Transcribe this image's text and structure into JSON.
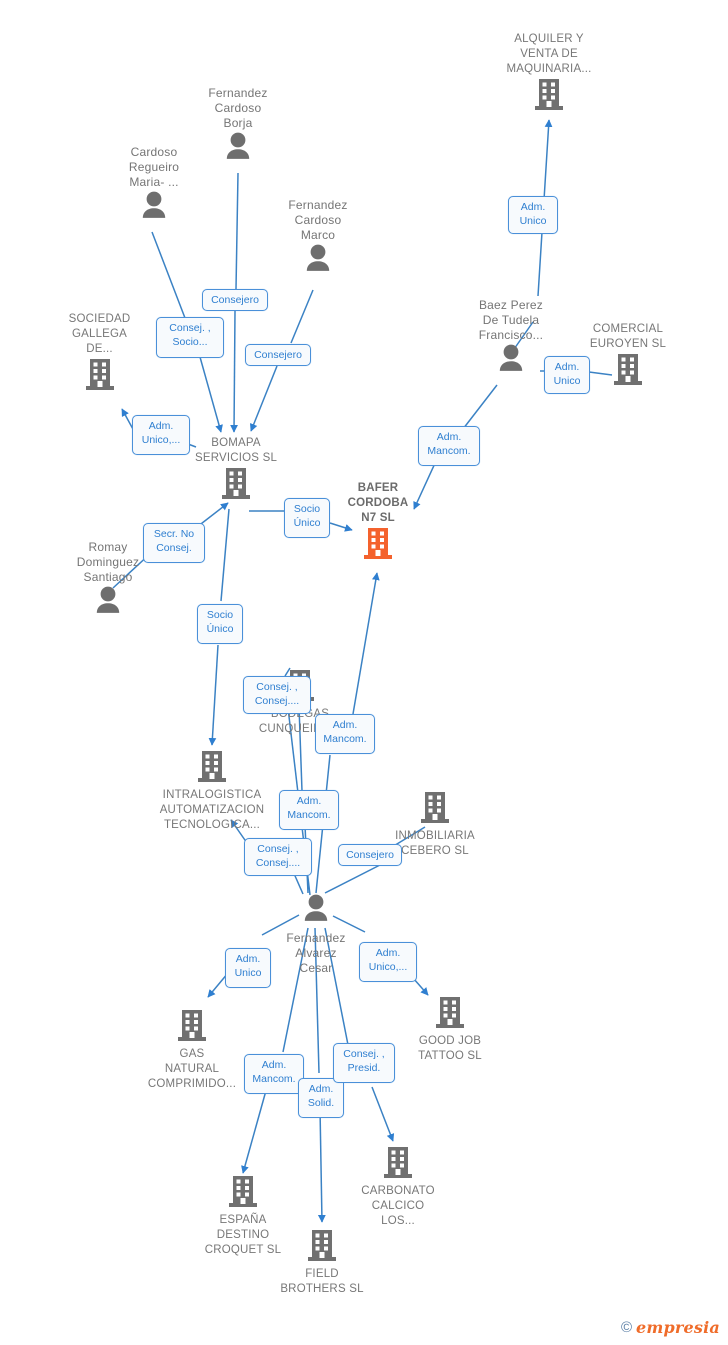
{
  "diagram": {
    "type": "corporate-relations-graph",
    "colors": {
      "focus_company": "#f4622d",
      "company": "#707070",
      "person": "#6e6e6e",
      "edge": "#3b82c4",
      "label_text": "#2f7fd0",
      "label_border": "#4a90d9",
      "caption_text": "#777777"
    },
    "focus_node": "BAFER CORDOBA N7 SL"
  },
  "nodes": [
    {
      "id": "alquiler",
      "kind": "company",
      "focus": false,
      "label": "ALQUILER Y\nVENTA DE\nMAQUINARIA..."
    },
    {
      "id": "fcborja",
      "kind": "person",
      "focus": false,
      "label": "Fernandez\nCardoso\nBorja"
    },
    {
      "id": "cardosomaria",
      "kind": "person",
      "focus": false,
      "label": "Cardoso\nRegueiro\nMaria- ..."
    },
    {
      "id": "fcmarco",
      "kind": "person",
      "focus": false,
      "label": "Fernandez\nCardoso\nMarco"
    },
    {
      "id": "sociedad",
      "kind": "company",
      "focus": false,
      "label": "SOCIEDAD\nGALLEGA\nDE..."
    },
    {
      "id": "baez",
      "kind": "person",
      "focus": false,
      "label": "Baez Perez\nDe Tudela\nFrancisco..."
    },
    {
      "id": "comercial",
      "kind": "company",
      "focus": false,
      "label": "COMERCIAL\nEUROYEN SL"
    },
    {
      "id": "bomapa",
      "kind": "company",
      "focus": false,
      "label": "BOMAPA\nSERVICIOS SL"
    },
    {
      "id": "bafer",
      "kind": "company",
      "focus": true,
      "label": "BAFER\nCORDOBA\nN7  SL"
    },
    {
      "id": "romay",
      "kind": "person",
      "focus": false,
      "label": "Romay\nDominguez\nSantiago"
    },
    {
      "id": "bodegas",
      "kind": "company",
      "focus": false,
      "label": "BODEGAS\nCUNQUEIRO..."
    },
    {
      "id": "intralogistica",
      "kind": "company",
      "focus": false,
      "label": "INTRALOGISTICA\nAUTOMATIZACION\nTECNOLOGICA..."
    },
    {
      "id": "inmobiliaria",
      "kind": "company",
      "focus": false,
      "label": "INMOBILIARIA\nCEBERO SL"
    },
    {
      "id": "cesar",
      "kind": "person",
      "focus": false,
      "label": "Fernandez\nAlvarez\nCesar"
    },
    {
      "id": "gas",
      "kind": "company",
      "focus": false,
      "label": "GAS\nNATURAL\nCOMPRIMIDO..."
    },
    {
      "id": "goodjob",
      "kind": "company",
      "focus": false,
      "label": "GOOD JOB\nTATTOO  SL"
    },
    {
      "id": "espana",
      "kind": "company",
      "focus": false,
      "label": "ESPAÑA\nDESTINO\nCROQUET  SL"
    },
    {
      "id": "field",
      "kind": "company",
      "focus": false,
      "label": "FIELD\nBROTHERS  SL"
    },
    {
      "id": "carbonato",
      "kind": "company",
      "focus": false,
      "label": "CARBONATO\nCALCICO\nLOS..."
    }
  ],
  "relation_labels": [
    {
      "id": "r1",
      "text": "Consejero",
      "from": "fcborja",
      "to": "bomapa"
    },
    {
      "id": "r2",
      "text": "Consej. ,\nSocio...",
      "from": "cardosomaria",
      "to": "bomapa"
    },
    {
      "id": "r3",
      "text": "Consejero",
      "from": "fcmarco",
      "to": "bomapa"
    },
    {
      "id": "r4",
      "text": "Adm.\nUnico,...",
      "from": "bomapa",
      "to": "sociedad"
    },
    {
      "id": "r5",
      "text": "Adm.\nUnico",
      "from": "baez",
      "to": "alquiler"
    },
    {
      "id": "r6",
      "text": "Adm.\nUnico",
      "from": "baez",
      "to": "comercial"
    },
    {
      "id": "r7",
      "text": "Adm.\nMancom.",
      "from": "baez",
      "to": "bafer"
    },
    {
      "id": "r8",
      "text": "Socio\nÚnico",
      "from": "bomapa",
      "to": "bafer"
    },
    {
      "id": "r9",
      "text": "Secr.  No\nConsej.",
      "from": "romay",
      "to": "bomapa"
    },
    {
      "id": "r10",
      "text": "Socio\nÚnico",
      "from": "bomapa",
      "to": "intralogistica"
    },
    {
      "id": "r11",
      "text": "Consej. ,\nConsej....",
      "from": "cesar",
      "to": "bodegas"
    },
    {
      "id": "r12",
      "text": "Adm.\nMancom.",
      "from": "cesar",
      "to": "bafer"
    },
    {
      "id": "r13",
      "text": "Adm.\nMancom.",
      "from": "cesar",
      "to": "bodegas"
    },
    {
      "id": "r14",
      "text": "Consej. ,\nConsej....",
      "from": "cesar",
      "to": "intralogistica"
    },
    {
      "id": "r15",
      "text": "Consejero",
      "from": "cesar",
      "to": "inmobiliaria"
    },
    {
      "id": "r16",
      "text": "Adm.\nUnico",
      "from": "cesar",
      "to": "gas"
    },
    {
      "id": "r17",
      "text": "Adm.\nUnico,...",
      "from": "cesar",
      "to": "goodjob"
    },
    {
      "id": "r18",
      "text": "Adm.\nMancom.",
      "from": "cesar",
      "to": "espana"
    },
    {
      "id": "r19",
      "text": "Adm.\nSolid.",
      "from": "cesar",
      "to": "field"
    },
    {
      "id": "r20",
      "text": "Consej. ,\nPresid.",
      "from": "cesar",
      "to": "carbonato"
    }
  ],
  "watermark": {
    "copyright": "©",
    "brand": "empresia"
  }
}
